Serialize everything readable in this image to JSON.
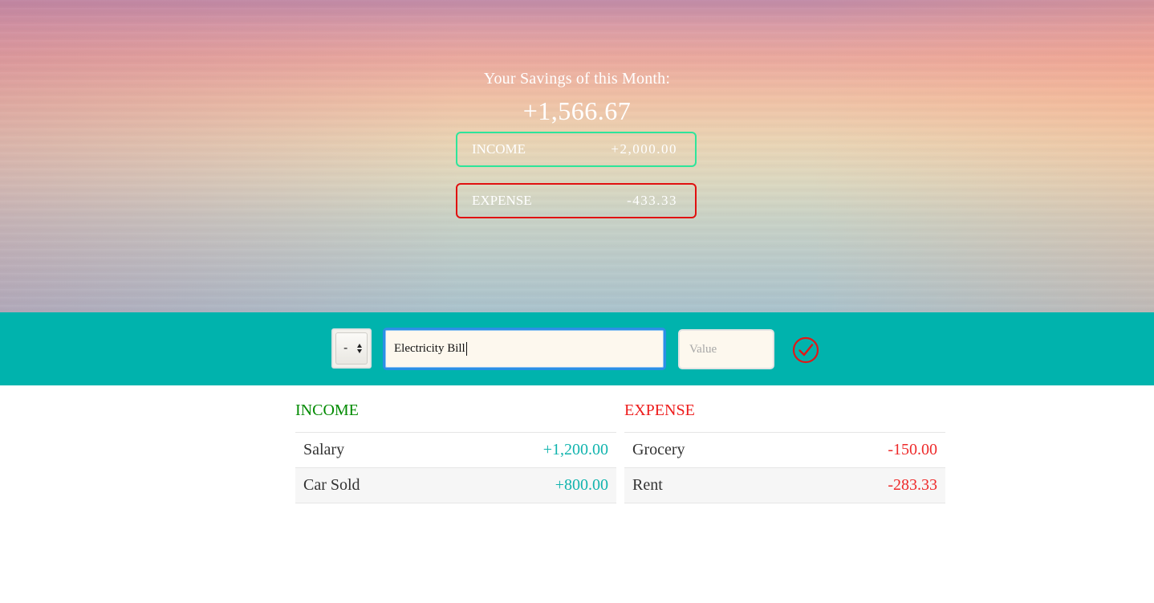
{
  "hero": {
    "savings_label": "Your Savings of this Month:",
    "savings_value": "+1,566.67",
    "income_label": "INCOME",
    "income_value": "+2,000.00",
    "expense_label": "EXPENSE",
    "expense_value": "-433.33"
  },
  "add_bar": {
    "type_selected": "-",
    "description_value": "Electricity Bill",
    "value_placeholder": "Value",
    "confirm_icon": "check-circle-icon"
  },
  "income_list": {
    "title": "INCOME",
    "items": [
      {
        "description": "Salary",
        "amount": "+1,200.00"
      },
      {
        "description": "Car Sold",
        "amount": "+800.00"
      }
    ]
  },
  "expense_list": {
    "title": "EXPENSE",
    "items": [
      {
        "description": "Grocery",
        "amount": "-150.00"
      },
      {
        "description": "Rent",
        "amount": "-283.33"
      }
    ]
  },
  "colors": {
    "add_bar_bg": "#00b3ad",
    "income_border": "#2ee59a",
    "expense_border": "#e01010",
    "income_title": "#008a00",
    "expense_title": "#ee1b1b",
    "income_amount": "#11b4ae",
    "expense_amount": "#ee2a2a"
  }
}
